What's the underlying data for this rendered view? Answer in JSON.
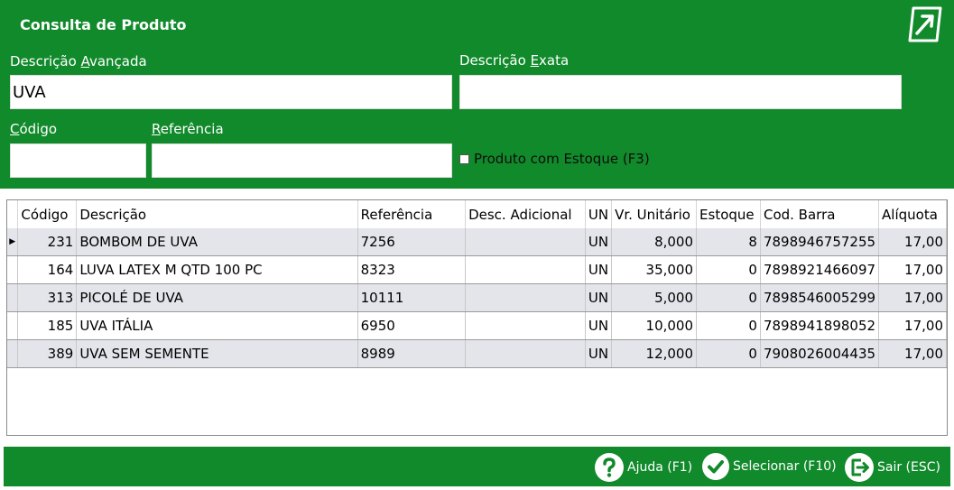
{
  "window": {
    "title": "Consulta de Produto"
  },
  "filters": {
    "descricao_avancada": {
      "label_pre": "Descrição ",
      "label_key": "A",
      "label_post": "vançada",
      "value": "UVA"
    },
    "descricao_exata": {
      "label_pre": "Descrição ",
      "label_key": "E",
      "label_post": "xata",
      "value": ""
    },
    "codigo": {
      "label_key": "C",
      "label_post": "ódigo",
      "value": ""
    },
    "referencia": {
      "label_key": "R",
      "label_post": "eferência",
      "value": ""
    },
    "produto_com_estoque": {
      "label": "Produto com Estoque (F3)",
      "checked": false
    }
  },
  "grid": {
    "columns": [
      "Código",
      "Descrição",
      "Referência",
      "Desc. Adicional",
      "UN",
      "Vr. Unitário",
      "Estoque",
      "Cod. Barra",
      "Alíquota"
    ],
    "selected_indicator": "▶",
    "rows": [
      {
        "codigo": "231",
        "descricao": "BOMBOM DE UVA",
        "referencia": "7256",
        "desc_adicional": "",
        "un": "UN",
        "vr_unitario": "8,000",
        "estoque": "8",
        "cod_barra": "7898946757255",
        "aliquota": "17,00"
      },
      {
        "codigo": "164",
        "descricao": "LUVA LATEX M QTD 100 PC",
        "referencia": "8323",
        "desc_adicional": "",
        "un": "UN",
        "vr_unitario": "35,000",
        "estoque": "0",
        "cod_barra": "7898921466097",
        "aliquota": "17,00"
      },
      {
        "codigo": "313",
        "descricao": "PICOLÉ DE UVA",
        "referencia": "10111",
        "desc_adicional": "",
        "un": "UN",
        "vr_unitario": "5,000",
        "estoque": "0",
        "cod_barra": "7898546005299",
        "aliquota": "17,00"
      },
      {
        "codigo": "185",
        "descricao": "UVA ITÁLIA",
        "referencia": "6950",
        "desc_adicional": "",
        "un": "UN",
        "vr_unitario": "10,000",
        "estoque": "0",
        "cod_barra": "7898941898052",
        "aliquota": "17,00"
      },
      {
        "codigo": "389",
        "descricao": "UVA SEM SEMENTE",
        "referencia": "8989",
        "desc_adicional": "",
        "un": "UN",
        "vr_unitario": "12,000",
        "estoque": "0",
        "cod_barra": "7908026004435",
        "aliquota": "17,00"
      }
    ]
  },
  "footer": {
    "ajuda": "Ajuda (F1)",
    "selecionar": "Selecionar (F10)",
    "sair": "Sair (ESC)"
  },
  "colors": {
    "brand_green": "#118a2b",
    "row_alt": "#e4e5ea"
  },
  "icons": [
    "exit-app-icon",
    "help-icon",
    "check-icon",
    "exit-door-icon",
    "row-indicator-icon"
  ]
}
